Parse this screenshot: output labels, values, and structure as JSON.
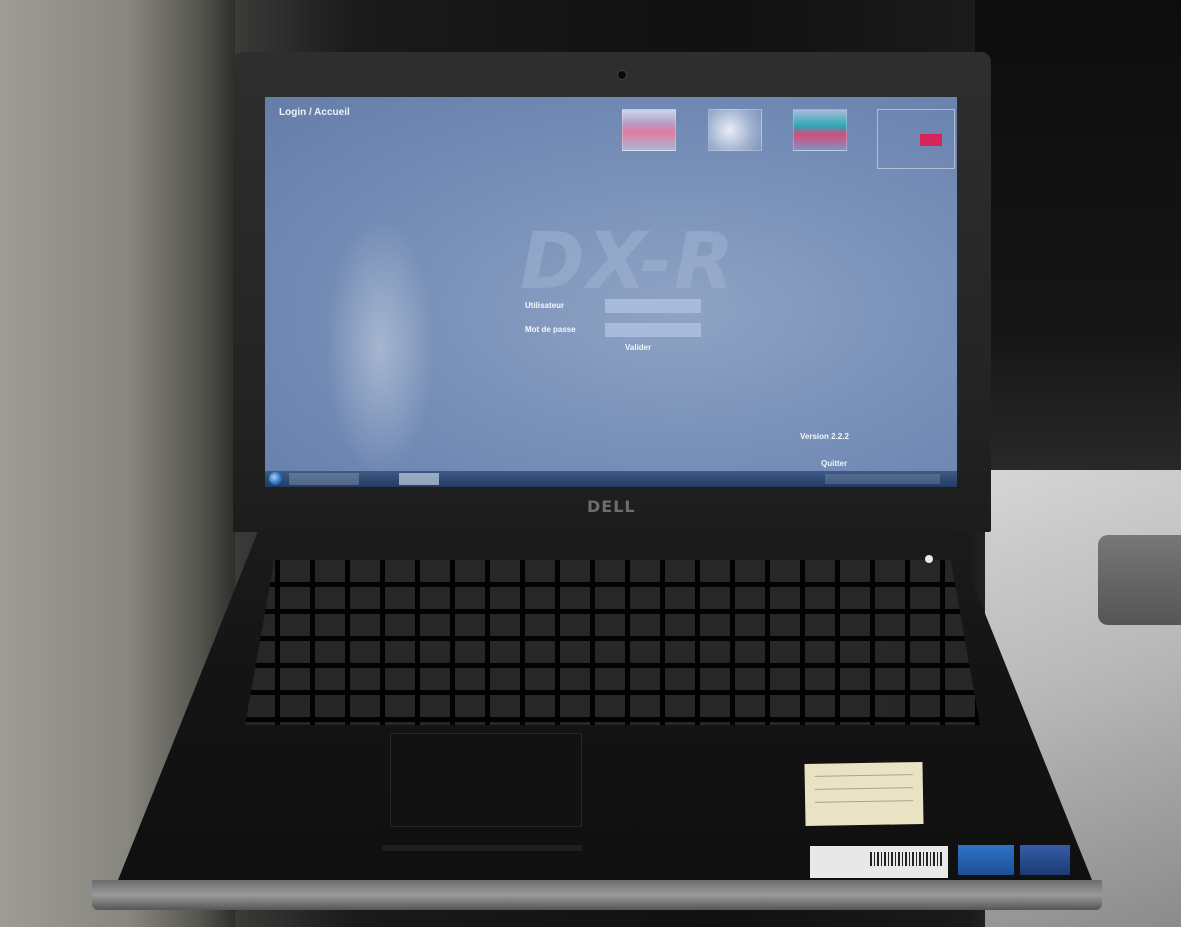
{
  "screen": {
    "app_title": "Login / Accueil",
    "watermark": "DX-R",
    "form": {
      "username_label": "Utilisateur",
      "password_label": "Mot de passe",
      "username_value": "",
      "password_value": "",
      "login_button": "Valider"
    },
    "version": "Version 2.2.2",
    "bottom_links": [
      "",
      "",
      "Quitter"
    ],
    "accent_color": "#d7255b",
    "background_color": "#7b93ba"
  },
  "laptop": {
    "brand": "DELL"
  },
  "icons": {
    "start": "windows-start-orb-icon",
    "power": "power-led-icon"
  }
}
